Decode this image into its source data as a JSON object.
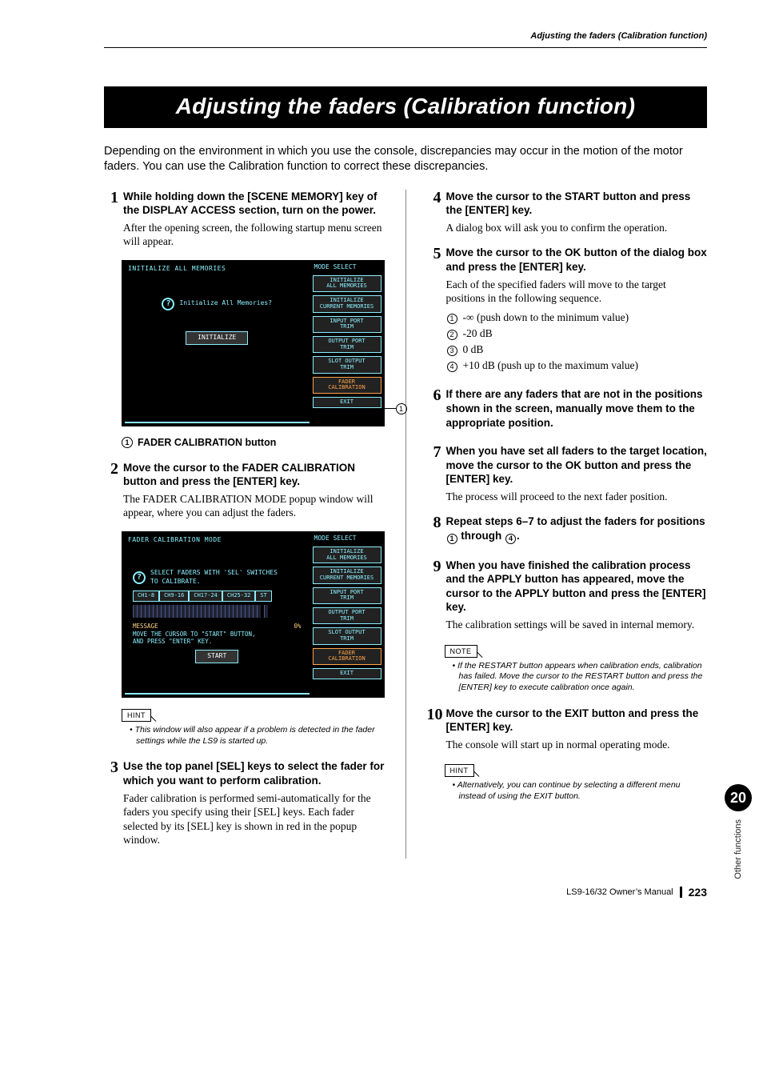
{
  "running_head": "Adjusting the faders (Calibration function)",
  "title": "Adjusting the faders (Calibration function)",
  "intro": "Depending on the environment in which you use the console, discrepancies may occur in the motion of the motor faders. You can use the Calibration function to correct these discrepancies.",
  "screenshot1": {
    "left_title": "INITIALIZE ALL MEMORIES",
    "dialog_text": "Initialize All Memories?",
    "initialize_btn": "INITIALIZE",
    "mode_title": "MODE SELECT",
    "buttons": [
      "INITIALIZE\nALL MEMORIES",
      "INITIALIZE\nCURRENT MEMORIES",
      "INPUT PORT\nTRIM",
      "OUTPUT PORT\nTRIM",
      "SLOT OUTPUT\nTRIM",
      "FADER\nCALIBRATION",
      "EXIT"
    ]
  },
  "caption1": {
    "num": "1",
    "text": "FADER CALIBRATION button"
  },
  "screenshot2": {
    "left_title": "FADER CALIBRATION MODE",
    "dialog_text": "SELECT FADERS WITH 'SEL' SWITCHES\nTO CALIBRATE.",
    "toggles": [
      "CH1-8",
      "CH9-16",
      "CH17-24",
      "CH25-32",
      "ST"
    ],
    "msg_label": "MESSAGE",
    "msg_pct": "0%",
    "msg_text": "MOVE THE CURSOR TO \"START\" BUTTON,\nAND PRESS \"ENTER\" KEY.",
    "start_btn": "START",
    "mode_title": "MODE SELECT",
    "buttons": [
      "INITIALIZE\nALL MEMORIES",
      "INITIALIZE\nCURRENT MEMORIES",
      "INPUT PORT\nTRIM",
      "OUTPUT PORT\nTRIM",
      "SLOT OUTPUT\nTRIM",
      "FADER\nCALIBRATION",
      "EXIT"
    ]
  },
  "steps_left": [
    {
      "n": "1",
      "head": "While holding down the [SCENE MEMORY] key of the DISPLAY ACCESS section, turn on the power.",
      "body": "After the opening screen, the following startup menu screen will appear."
    },
    {
      "n": "2",
      "head": "Move the cursor to the FADER CALIBRATION button and press the [ENTER] key.",
      "body": "The FADER CALIBRATION MODE popup window will appear, where you can adjust the faders."
    },
    {
      "n": "3",
      "head": "Use the top panel [SEL] keys to select the fader for which you want to perform calibration.",
      "body": "Fader calibration is performed semi-automatically for the faders you specify using their [SEL] keys. Each fader selected by its [SEL] key is shown in red in the popup window."
    }
  ],
  "hint1": "This window will also appear if a problem is detected in the fader settings while the LS9 is started up.",
  "steps_right": [
    {
      "n": "4",
      "head": "Move the cursor to the START button and press the [ENTER] key.",
      "body": "A dialog box will ask you to confirm the operation."
    },
    {
      "n": "5",
      "head": "Move the cursor to the OK button of the dialog box and press the [ENTER] key.",
      "body": "Each of the specified faders will move to the target positions in the following sequence."
    },
    {
      "n": "6",
      "head": "If there are any faders that are not in the positions shown in the screen, manually move them to the appropriate position.",
      "body": ""
    },
    {
      "n": "7",
      "head": "When you have set all faders to the target location, move the cursor to the OK button and press the [ENTER] key.",
      "body": "The process will proceed to the next fader position."
    },
    {
      "n": "8",
      "head_parts": [
        "Repeat steps 6–7 to adjust the faders for positions ",
        " through ",
        "."
      ],
      "body": ""
    },
    {
      "n": "9",
      "head": "When you have finished the calibration process and the APPLY button has appeared, move the cursor to the APPLY button and press the [ENTER] key.",
      "body": "The calibration settings will be saved in internal memory."
    },
    {
      "n": "10",
      "head": "Move the cursor to the EXIT button and press the [ENTER] key.",
      "body": "The console will start up in normal operating mode."
    }
  ],
  "sequence": [
    {
      "n": "1",
      "text": "-∞ (push down to the minimum value)"
    },
    {
      "n": "2",
      "text": "-20 dB"
    },
    {
      "n": "3",
      "text": "0 dB"
    },
    {
      "n": "4",
      "text": "+10 dB (push up to the maximum value)"
    }
  ],
  "note1": "If the RESTART button appears when calibration ends, calibration has failed. Move the cursor to the RESTART button and press the [ENTER] key to execute calibration once again.",
  "hint2": "Alternatively, you can continue by selecting a different menu instead of using the EXIT button.",
  "labels": {
    "hint": "HINT",
    "note": "NOTE"
  },
  "side": {
    "chapter": "20",
    "label": "Other functions"
  },
  "footer": {
    "manual": "LS9-16/32  Owner’s Manual",
    "page": "223"
  }
}
